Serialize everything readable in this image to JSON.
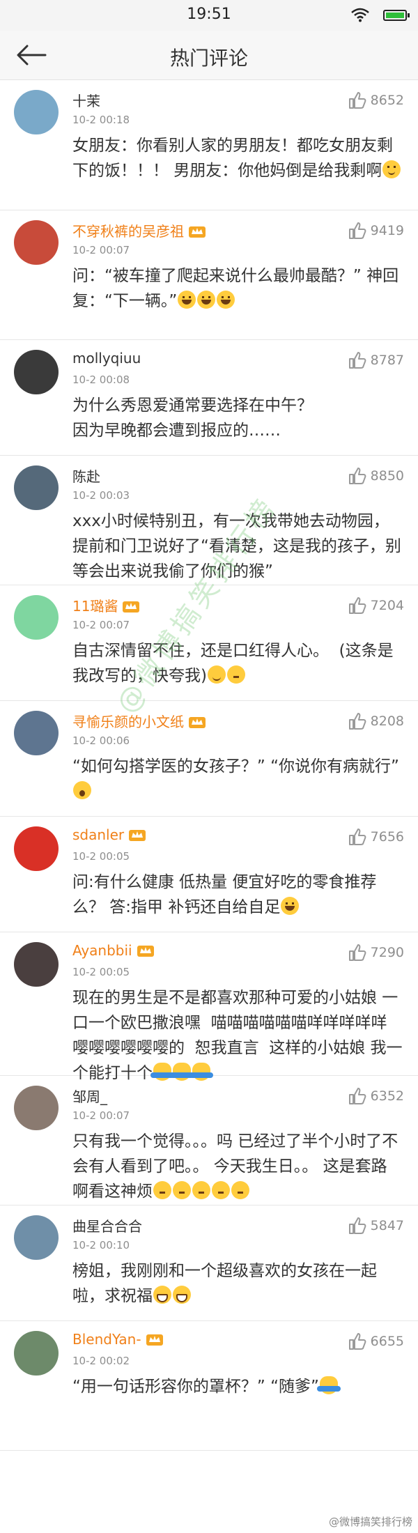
{
  "status": {
    "time": "19:51"
  },
  "nav": {
    "title": "热门评论"
  },
  "comments": [
    {
      "name": "十茉",
      "time": "10-2 00:18",
      "likes": "8652",
      "text": "女朋友：你看别人家的男朋友！都吃女朋友剩下的饭！！！ 男朋友：你他妈倒是给我剩啊",
      "vip": false,
      "avatar_color": "#7aa9c9",
      "emojis": [
        "smile"
      ]
    },
    {
      "name": "不穿秋裤的吴彦祖",
      "time": "10-2 00:07",
      "likes": "9419",
      "text": "问：“被车撞了爬起来说什么最帅最酷？” 神回复：“下一辆。”",
      "vip": true,
      "avatar_color": "#c84b3a",
      "emojis": [
        "laugh",
        "laugh",
        "laugh"
      ]
    },
    {
      "name": "mollyqiuu",
      "time": "10-2 00:08",
      "likes": "8787",
      "text": "为什么秀恩爱通常要选择在中午？\n因为早晚都会遭到报应的……",
      "vip": false,
      "avatar_color": "#3a3a3a",
      "emojis": []
    },
    {
      "name": "陈赴",
      "time": "10-2 00:03",
      "likes": "8850",
      "text": "xxx小时候特别丑，有一次我带她去动物园，提前和门卫说好了“看清楚，这是我的孩子，别等会出来说我偷了你们的猴”",
      "vip": false,
      "avatar_color": "#55697a",
      "emojis": []
    },
    {
      "name": "11璐酱",
      "time": "10-2 00:07",
      "likes": "7204",
      "text": "自古深情留不住，还是口红得人心。  (这条是我改写的，快夸我)",
      "vip": true,
      "avatar_color": "#7fd6a0",
      "emojis": [
        "wink",
        "think"
      ]
    },
    {
      "name": "寻愉乐颜的小文纸",
      "time": "10-2 00:06",
      "likes": "8208",
      "text": "“如何勾搭学医的女孩子？” “你说你有病就行”",
      "vip": true,
      "avatar_color": "#5e7590",
      "emojis": [
        "shock"
      ]
    },
    {
      "name": "sdanler",
      "time": "10-2 00:05",
      "likes": "7656",
      "text": "问:有什么健康 低热量 便宜好吃的零食推荐么？ 答:指甲 补钙还自给自足",
      "vip": true,
      "avatar_color": "#d93026",
      "emojis": [
        "laugh"
      ]
    },
    {
      "name": "Ayanbbii",
      "time": "10-2 00:05",
      "likes": "7290",
      "text": "现在的男生是不是都喜欢那种可爱的小姑娘 一口一个欧巴撒浪嘿  喵喵喵喵喵喵咩咩咩咩咩嘤嘤嘤嘤嘤嘤的  恕我直言  这样的小姑娘 我一个能打十个",
      "vip": true,
      "avatar_color": "#4a3f3f",
      "emojis": [
        "shrug",
        "shrug",
        "shrug"
      ]
    },
    {
      "name": "邹周_",
      "time": "10-2 00:07",
      "likes": "6352",
      "text": "只有我一个觉得。。。吗 已经过了半个小时了不会有人看到了吧。。 今天我生日。。 这是套路啊看这神烦",
      "vip": false,
      "avatar_color": "#8a7a70",
      "emojis": [
        "think",
        "think",
        "think",
        "think",
        "think"
      ]
    },
    {
      "name": "曲星合合合",
      "time": "10-2 00:10",
      "likes": "5847",
      "text": "榜姐，我刚刚和一个超级喜欢的女孩在一起啦，求祝福",
      "vip": false,
      "avatar_color": "#6f8fa8",
      "emojis": [
        "grin",
        "grin"
      ]
    },
    {
      "name": "BlendYan-",
      "time": "10-2 00:02",
      "likes": "6655",
      "text": "“用一句话形容你的罩杯？” “随爹”",
      "vip": true,
      "avatar_color": "#6d8a6a",
      "emojis": [
        "shrug"
      ]
    }
  ],
  "watermark": "@微博搞笑排行榜",
  "footer": "@微博搞笑排行榜"
}
